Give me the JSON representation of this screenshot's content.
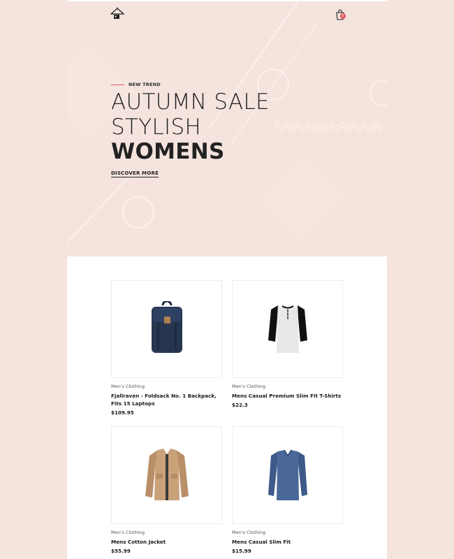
{
  "header": {
    "logo_icon": "hanger-house-logo-icon",
    "cart_icon": "shopping-bag-icon",
    "cart_count": "0",
    "accent_color": "#e0565b"
  },
  "hero": {
    "tagline": "NEW TREND",
    "line1": "AUTUMN SALE",
    "line2": "STYLISH",
    "line3": "WOMENS",
    "cta": "DISCOVER MORE"
  },
  "products": [
    {
      "category": "Men's Clothing",
      "title": "Fjallraven - Foldsack No. 1 Backpack, Fits 15 Laptops",
      "price": "$109.95",
      "image": "backpack-image"
    },
    {
      "category": "Men's Clothing",
      "title": "Mens Casual Premium Slim Fit T-Shirts",
      "price": "$22.3",
      "image": "raglan-tshirt-image"
    },
    {
      "category": "Men's Clothing",
      "title": "Mens Cotton Jacket",
      "price": "$55.99",
      "image": "cotton-jacket-image"
    },
    {
      "category": "Men's Clothing",
      "title": "Mens Casual Slim Fit",
      "price": "$15.99",
      "image": "slim-fit-shirt-image"
    }
  ]
}
